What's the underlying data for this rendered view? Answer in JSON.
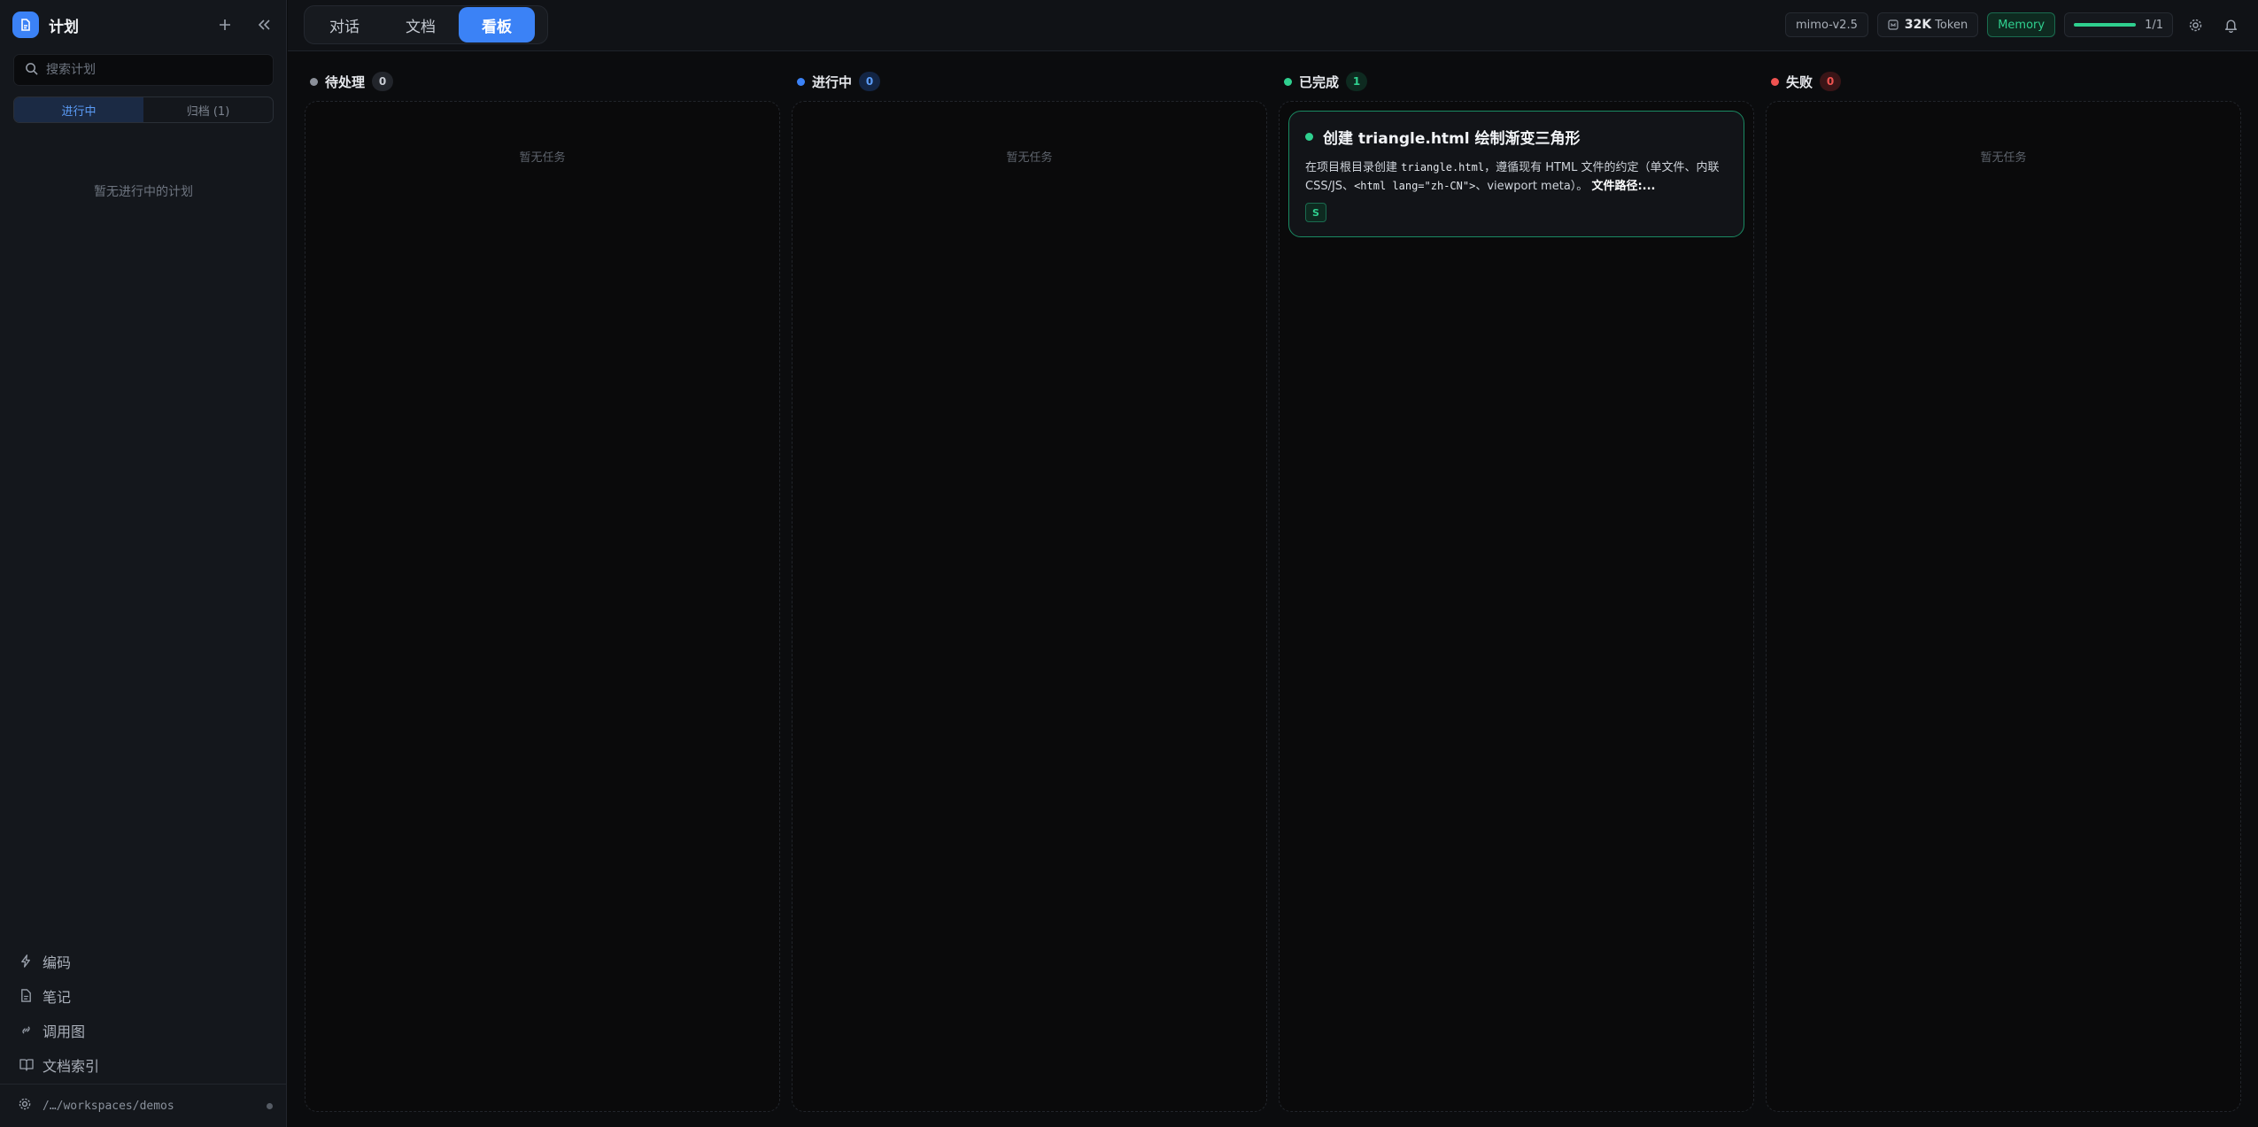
{
  "sidebar": {
    "title": "计划",
    "search_placeholder": "搜索计划",
    "segments": [
      {
        "label": "进行中",
        "active": true
      },
      {
        "label": "归档 (1)",
        "active": false
      }
    ],
    "empty_text": "暂无进行中的计划",
    "nav": [
      {
        "label": "编码",
        "icon": "lightning-icon"
      },
      {
        "label": "笔记",
        "icon": "file-icon"
      },
      {
        "label": "调用图",
        "icon": "link-icon"
      },
      {
        "label": "文档索引",
        "icon": "book-icon"
      }
    ],
    "workspace_path": "/…/workspaces/demos"
  },
  "topbar": {
    "tabs": [
      {
        "label": "对话",
        "active": false
      },
      {
        "label": "文档",
        "active": false
      },
      {
        "label": "看板",
        "active": true
      }
    ],
    "model": "mimo-v2.5",
    "token_value": "32K",
    "token_label": "Token",
    "memory_label": "Memory",
    "progress_fraction": 1.0,
    "progress_text": "1/1"
  },
  "board": {
    "columns": [
      {
        "title": "待处理",
        "count": "0",
        "dot_color": "#8b9099",
        "badge_bg": "#22252b",
        "badge_color": "#c8ccd3",
        "empty_text": "暂无任务"
      },
      {
        "title": "进行中",
        "count": "0",
        "dot_color": "#3b82f6",
        "badge_bg": "#132544",
        "badge_color": "#5b9cf7",
        "empty_text": "暂无任务"
      },
      {
        "title": "已完成",
        "count": "1",
        "dot_color": "#2fd08f",
        "badge_bg": "#0e2a20",
        "badge_color": "#2fd08f",
        "empty_text": ""
      },
      {
        "title": "失败",
        "count": "0",
        "dot_color": "#ef5350",
        "badge_bg": "#3a1517",
        "badge_color": "#ef5350",
        "empty_text": "暂无任务"
      }
    ],
    "card": {
      "title": "创建 triangle.html 绘制渐变三角形",
      "desc_1": "在项目根目录创建 ",
      "desc_code_1": "triangle.html",
      "desc_2": "，遵循现有 HTML 文件的约定（单文件、内联 CSS/JS、",
      "desc_code_2": "<html lang=\"zh-CN\">",
      "desc_3": "、viewport meta）。",
      "desc_bold": "文件路径:...",
      "tag": "S"
    }
  }
}
